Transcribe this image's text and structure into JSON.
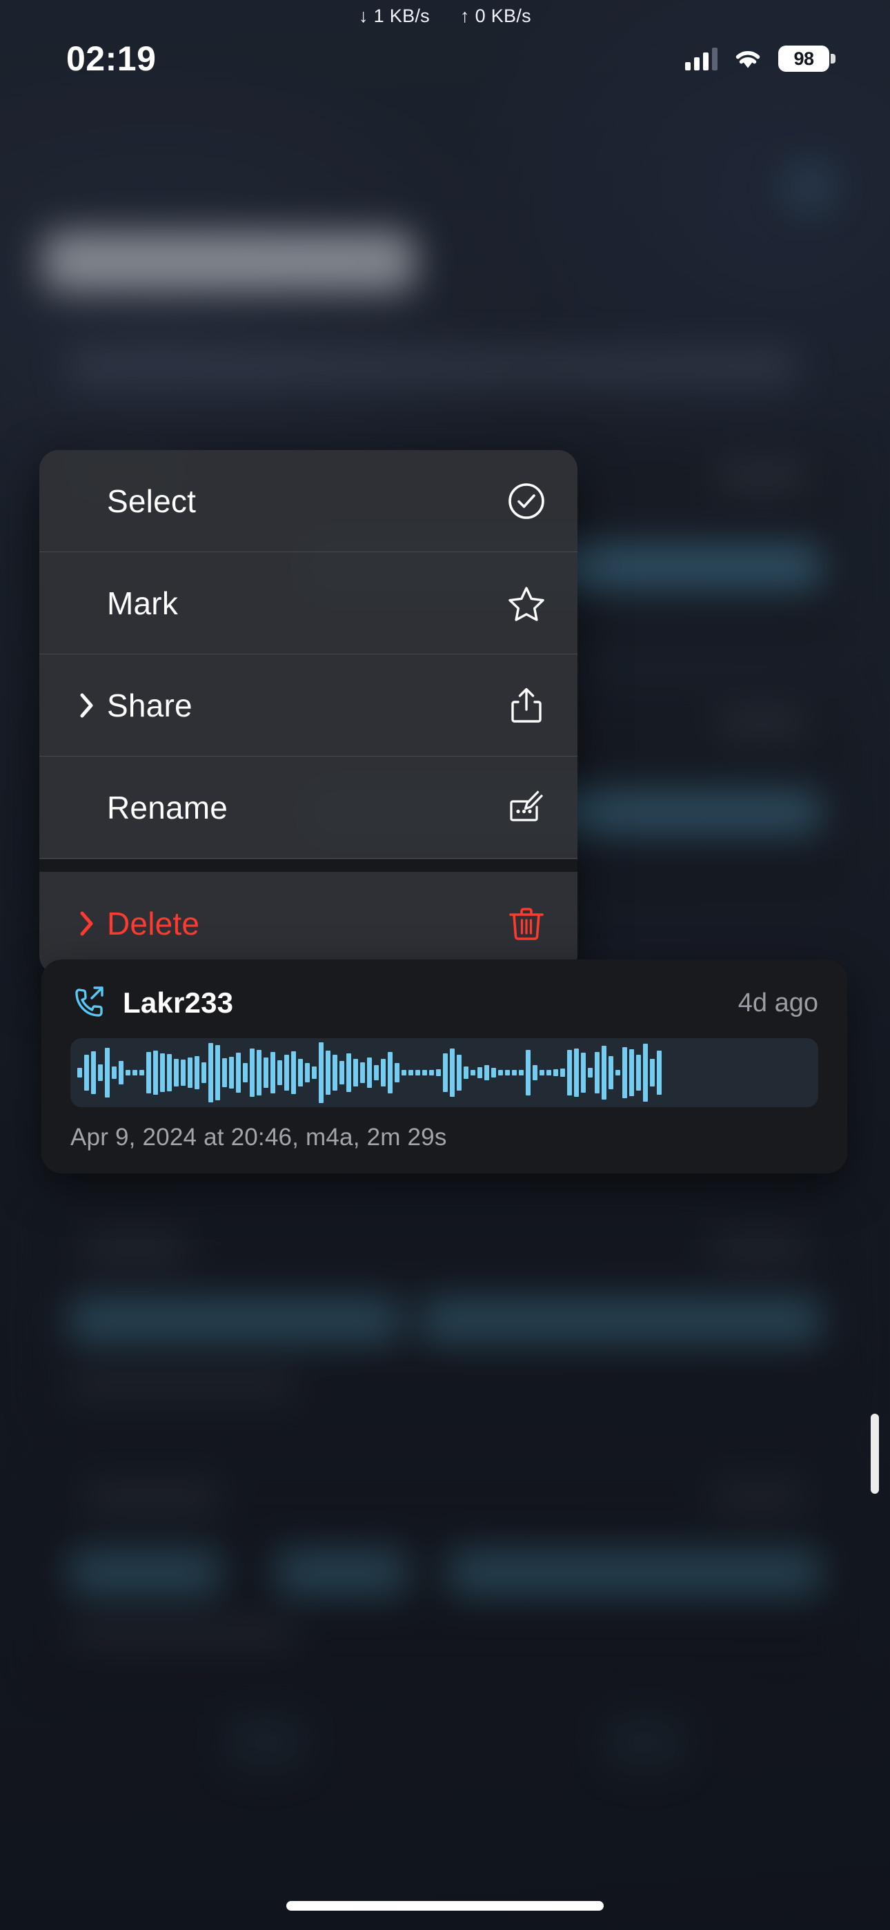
{
  "status_bar": {
    "download_speed": "↓ 1 KB/s",
    "upload_speed": "↑ 0 KB/s",
    "time": "02:19",
    "battery_percent": "98",
    "signal_icon": "cellular-signal-icon",
    "wifi_icon": "wifi-icon",
    "battery_icon": "battery-icon"
  },
  "context_menu": {
    "items": [
      {
        "label": "Select",
        "icon": "checkmark-circle-icon",
        "has_chevron": false,
        "destructive": false
      },
      {
        "label": "Mark",
        "icon": "star-icon",
        "has_chevron": false,
        "destructive": false
      },
      {
        "label": "Share",
        "icon": "share-icon",
        "has_chevron": true,
        "destructive": false
      },
      {
        "label": "Rename",
        "icon": "rename-pencil-icon",
        "has_chevron": false,
        "destructive": false
      },
      {
        "label": "Delete",
        "icon": "trash-icon",
        "has_chevron": true,
        "destructive": true
      }
    ],
    "destructive_color": "#ff3b2f"
  },
  "recording_card": {
    "call_icon": "outgoing-call-icon",
    "title": "Lakr233",
    "age": "4d ago",
    "meta": "Apr 9, 2024 at 20:46, m4a, 2m 29s",
    "waveform_color": "#74cdf0",
    "accent_color": "#5ac8f5",
    "waveform_heights": [
      14,
      52,
      62,
      24,
      72,
      18,
      34,
      8,
      8,
      8,
      60,
      64,
      56,
      54,
      40,
      38,
      44,
      48,
      30,
      86,
      80,
      42,
      46,
      58,
      28,
      70,
      66,
      44,
      60,
      36,
      52,
      62,
      40,
      28,
      18,
      88,
      64,
      52,
      34,
      56,
      40,
      30,
      44,
      22,
      40,
      60,
      28,
      8,
      8,
      8,
      8,
      8,
      10,
      56,
      70,
      52,
      18,
      8,
      16,
      22,
      14,
      8,
      8,
      8,
      8,
      66,
      22,
      8,
      8,
      10,
      12,
      66,
      70,
      58,
      14,
      60,
      78,
      48,
      8,
      74,
      68,
      52,
      84,
      40,
      64
    ]
  },
  "home_indicator": "home-indicator"
}
